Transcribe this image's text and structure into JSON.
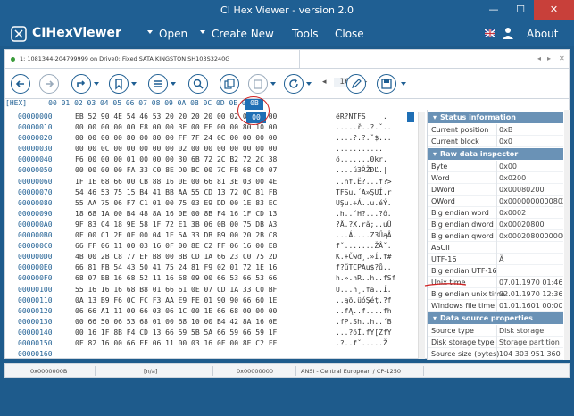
{
  "window": {
    "title": "CI Hex Viewer - version 2.0",
    "min": "—",
    "max": "☐",
    "close": "✕"
  },
  "menu": {
    "app_name": "CIHexViewer",
    "open": "Open",
    "create_new": "Create New",
    "tools": "Tools",
    "close": "Close",
    "about": "About"
  },
  "tab": {
    "label": "1: 1081344-204799999 on Drive0: Fixed SATA KINGSTON SH103S3240G",
    "scroll_left": "◂",
    "scroll_right": "▸",
    "close": "✕"
  },
  "toolbar": {
    "nav_left": "◂",
    "nav_value": "16",
    "nav_right": "▸"
  },
  "hex": {
    "header": "[HEX]     00 01 02 03 04 05 06 07 08 09 0A 0B 0C 0D 0E 0F",
    "selected_col": "0B",
    "selected_byte": "00",
    "offsets": "00000000\n00000010\n00000020\n00000030\n00000040\n00000050\n00000060\n00000070\n00000080\n00000090\n000000A0\n000000B0\n000000C0\n000000D0\n000000E0\n000000F0\n00000100\n00000110\n00000120\n00000130\n00000140\n00000150\n00000160",
    "bytes": "EB 52 90 4E 54 46 53 20 20 20 20 00 02 08 00 00\n00 00 00 00 00 F8 00 00 3F 00 FF 00 00 80 10 00\n00 00 00 00 80 00 80 00 FF 7F 24 0C 00 00 00 00\n00 00 0C 00 00 00 00 00 02 00 00 00 00 00 00 00\nF6 00 00 00 01 00 00 00 30 6B 72 2C B2 72 2C 38\n00 00 00 00 FA 33 C0 8E D0 BC 00 7C FB 68 C0 07\n1F 1E 68 66 00 CB 88 16 0E 00 66 81 3E 03 00 4E\n54 46 53 75 15 B4 41 BB AA 55 CD 13 72 0C 81 FB\n55 AA 75 06 F7 C1 01 00 75 03 E9 DD 00 1E 83 EC\n18 68 1A 00 B4 48 8A 16 0E 00 8B F4 16 1F CD 13\n9F 83 C4 18 9E 58 1F 72 E1 3B 06 0B 00 75 DB A3\n0F 00 C1 2E 0F 00 04 1E 5A 33 DB B9 00 20 2B C8\n66 FF 06 11 00 03 16 0F 00 8E C2 FF 06 16 00 E8\n4B 00 2B C8 77 EF B8 00 BB CD 1A 66 23 C0 75 2D\n66 81 FB 54 43 50 41 75 24 81 F9 02 01 72 1E 16\n68 07 BB 16 68 52 11 16 68 09 00 66 53 66 53 66\n55 16 16 16 68 B8 01 66 61 0E 07 CD 1A 33 C0 BF\n0A 13 B9 F6 0C FC F3 AA E9 FE 01 90 90 66 60 1E\n06 66 A1 11 00 66 03 06 1C 00 1E 66 68 00 00 00\n00 66 50 06 53 68 01 00 68 10 00 B4 42 8A 16 0E\n00 16 1F 8B F4 CD 13 66 59 5B 5A 66 59 66 59 1F\n0F 82 16 00 66 FF 06 11 00 03 16 0F 00 8E C2 FF",
    "ascii": "ëR?NTFS    .\n.....ř..?.ˇ..\n....?.?.ˇ$...\n...........\nö.......0kr,\n....ú3ŔŽĐĽ.|\n..hf.Ë?...f?>\nTFSu.´A»ŞUÍ.r\nUŞu.÷Á..u.éÝ.\n.h..´H?...?ô.\n?Ä.?X.ră;..uŰ\n...Á....Z3ŰąÂ\nfˇ.......ŽÂˇ.\nK.+Čwď¸.»Í.f#\nf?űTCPAu$?ů..\nh.».hR..h..fSf\nU...h¸.fa..Í.\n..ąö.üóŞéţ.?f\n..fĄ..f....fh\n.fP.Sh..h..´B\n...?ôÍ.fY[ZfY\n.?..fˇ.....Ž"
  },
  "panel": {
    "status_header": "Status information",
    "status_rows": [
      {
        "key": "Current position",
        "value": "0xB"
      },
      {
        "key": "Current block",
        "value": "0x0"
      }
    ],
    "raw_header": "Raw data inspector",
    "raw_rows": [
      {
        "key": "Byte",
        "value": "0x00"
      },
      {
        "key": "Word",
        "value": "0x0200"
      },
      {
        "key": "DWord",
        "value": "0x00080200"
      },
      {
        "key": "QWord",
        "value": "0x000000000080200"
      },
      {
        "key": "Big endian word",
        "value": "0x0002"
      },
      {
        "key": "Big endian dword",
        "value": "0x00020800"
      },
      {
        "key": "Big endian qword",
        "value": "0x0002080000000000"
      },
      {
        "key": "ASCII",
        "value": ""
      },
      {
        "key": "UTF-16",
        "value": "Ȁ"
      },
      {
        "key": "Big endian UTF-16",
        "value": ""
      },
      {
        "key": "Unix time",
        "value": "07.01.1970 01:46:40"
      },
      {
        "key": "Big endian unix time",
        "value": "02.01.1970 12:36:40"
      },
      {
        "key": "Windows file time",
        "value": "01.01.1601 00:00:00"
      }
    ],
    "ds_header": "Data source properties",
    "ds_rows": [
      {
        "key": "Source type",
        "value": "Disk storage"
      },
      {
        "key": "Disk storage type",
        "value": "Storage partition"
      },
      {
        "key": "Source size (bytes)",
        "value": "104 303 951 360"
      }
    ]
  },
  "status": {
    "offset": "0x0000000B",
    "value": "[n/a]",
    "offset2": "0x00000000",
    "encoding": "ANSI - Central European / CP-1250"
  },
  "colors": {
    "titlebar": "#1f5f93",
    "accent": "#1f6fb5",
    "panel_header": "#6a92b6",
    "annotation": "#d02020"
  }
}
